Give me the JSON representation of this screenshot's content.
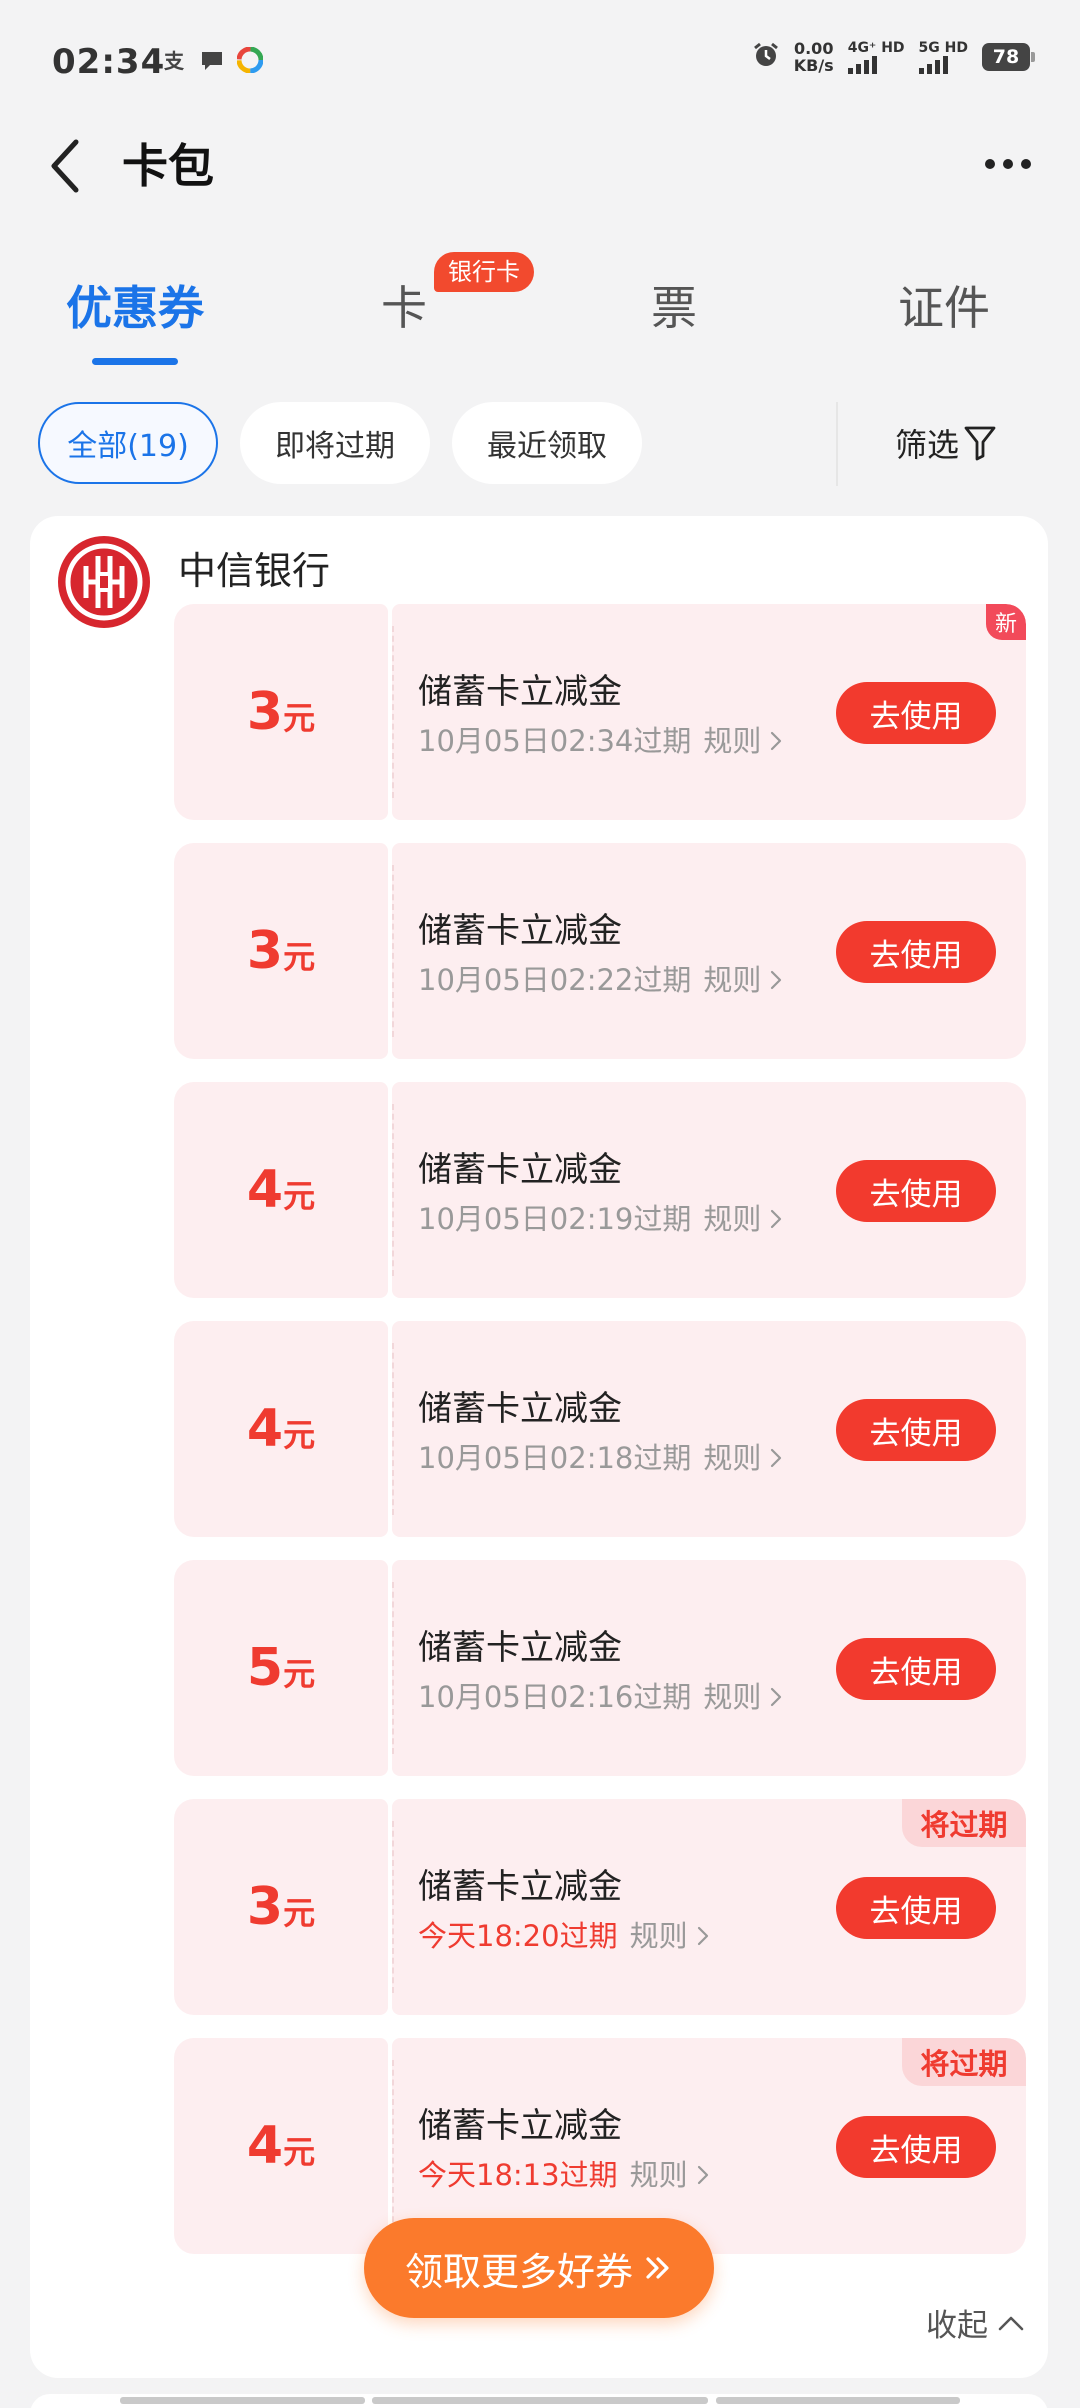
{
  "status_bar": {
    "time": "02:34",
    "net_speed_value": "0.00",
    "net_speed_unit": "KB/s",
    "signal1": "4G⁺ HD",
    "signal2": "5G HD",
    "battery": "78",
    "icons": [
      "alipay-icon",
      "message-icon",
      "colorful-app-icon",
      "alarm-icon"
    ]
  },
  "header": {
    "title": "卡包"
  },
  "tabs": [
    {
      "label": "优惠券",
      "active": true
    },
    {
      "label": "卡",
      "badge": "银行卡"
    },
    {
      "label": "票"
    },
    {
      "label": "证件"
    }
  ],
  "filters": {
    "chips": [
      {
        "label": "全部(19)",
        "active": true
      },
      {
        "label": "即将过期"
      },
      {
        "label": "最近领取"
      }
    ],
    "filter_label": "筛选"
  },
  "bank": {
    "name": "中信银行",
    "coupons": [
      {
        "amount": "3",
        "unit": "元",
        "title": "储蓄卡立减金",
        "expiry": "10月05日02:34过期",
        "urgent": false,
        "rules": "规则",
        "button": "去使用",
        "tag": "新"
      },
      {
        "amount": "3",
        "unit": "元",
        "title": "储蓄卡立减金",
        "expiry": "10月05日02:22过期",
        "urgent": false,
        "rules": "规则",
        "button": "去使用",
        "tag": ""
      },
      {
        "amount": "4",
        "unit": "元",
        "title": "储蓄卡立减金",
        "expiry": "10月05日02:19过期",
        "urgent": false,
        "rules": "规则",
        "button": "去使用",
        "tag": ""
      },
      {
        "amount": "4",
        "unit": "元",
        "title": "储蓄卡立减金",
        "expiry": "10月05日02:18过期",
        "urgent": false,
        "rules": "规则",
        "button": "去使用",
        "tag": ""
      },
      {
        "amount": "5",
        "unit": "元",
        "title": "储蓄卡立减金",
        "expiry": "10月05日02:16过期",
        "urgent": false,
        "rules": "规则",
        "button": "去使用",
        "tag": ""
      },
      {
        "amount": "3",
        "unit": "元",
        "title": "储蓄卡立减金",
        "expiry": "今天18:20过期",
        "urgent": true,
        "rules": "规则",
        "button": "去使用",
        "tag": "将过期"
      },
      {
        "amount": "4",
        "unit": "元",
        "title": "储蓄卡立减金",
        "expiry": "今天18:13过期",
        "urgent": true,
        "rules": "规则",
        "button": "去使用",
        "tag": "将过期"
      }
    ]
  },
  "actions": {
    "more_coupons": "领取更多好券",
    "collapse": "收起"
  },
  "colors": {
    "accent_blue": "#1b74e8",
    "coupon_red": "#ef3b30",
    "coupon_bg": "#fdeef0",
    "cta_orange": "#fb7a2c"
  }
}
